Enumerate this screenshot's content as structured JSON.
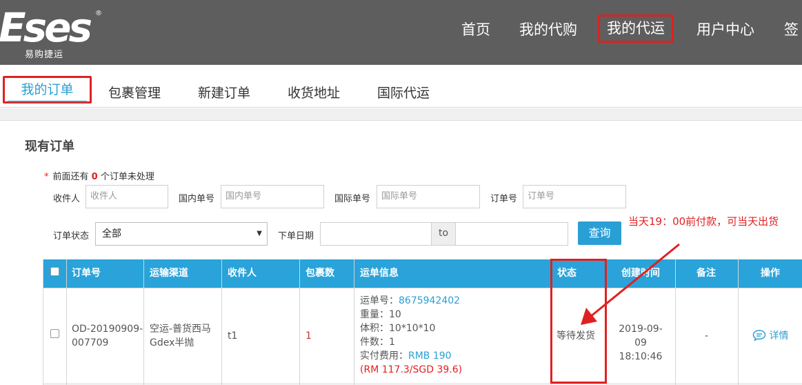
{
  "header": {
    "logo_text": "Eses",
    "logo_subtitle": "易购捷运",
    "nav": [
      "首页",
      "我的代购",
      "我的代运",
      "用户中心",
      "签"
    ]
  },
  "subtabs": [
    "我的订单",
    "包裹管理",
    "新建订单",
    "收货地址",
    "国际代运"
  ],
  "panel": {
    "title": "现有订单",
    "notice_prefix": "前面还有",
    "notice_count": "0",
    "notice_suffix": "个订单未处理",
    "star": "*"
  },
  "filters": {
    "recipient_label": "收件人",
    "recipient_placeholder": "收件人",
    "domestic_label": "国内单号",
    "domestic_placeholder": "国内单号",
    "intl_label": "国际单号",
    "intl_placeholder": "国际单号",
    "order_label": "订单号",
    "order_placeholder": "订单号",
    "status_label": "订单状态",
    "status_value": "全部",
    "date_label": "下单日期",
    "date_to": "to",
    "query_button": "查询"
  },
  "annotation": {
    "text": "当天19：00前付款，可当天出货",
    "color": "#e02020"
  },
  "table": {
    "headers": [
      "订单号",
      "运输渠道",
      "收件人",
      "包裹数",
      "运单信息",
      "状态",
      "创建时间",
      "备注",
      "操作"
    ],
    "row": {
      "order_no_1": "OD-20190909-",
      "order_no_2": "007709",
      "channel_1": "空运-普货西马",
      "channel_2": "Gdex半抛",
      "recipient": "t1",
      "packages": "1",
      "waybill_label": "运单号：",
      "waybill_no": "8675942402",
      "weight": "重量：10",
      "volume": "体积：10*10*10",
      "pieces": "件数：1",
      "paid_label": "实付费用：",
      "paid_value": "RMB 190",
      "paid_local": "(RM 117.3/SGD 39.6)",
      "status": "等待发货",
      "created_date": "2019-09-09",
      "created_time": "18:10:46",
      "remark": "-",
      "action": "详情"
    }
  },
  "colors": {
    "header_bg": "#5e5e5e",
    "accent": "#29a3d9",
    "highlight": "#e02020"
  }
}
